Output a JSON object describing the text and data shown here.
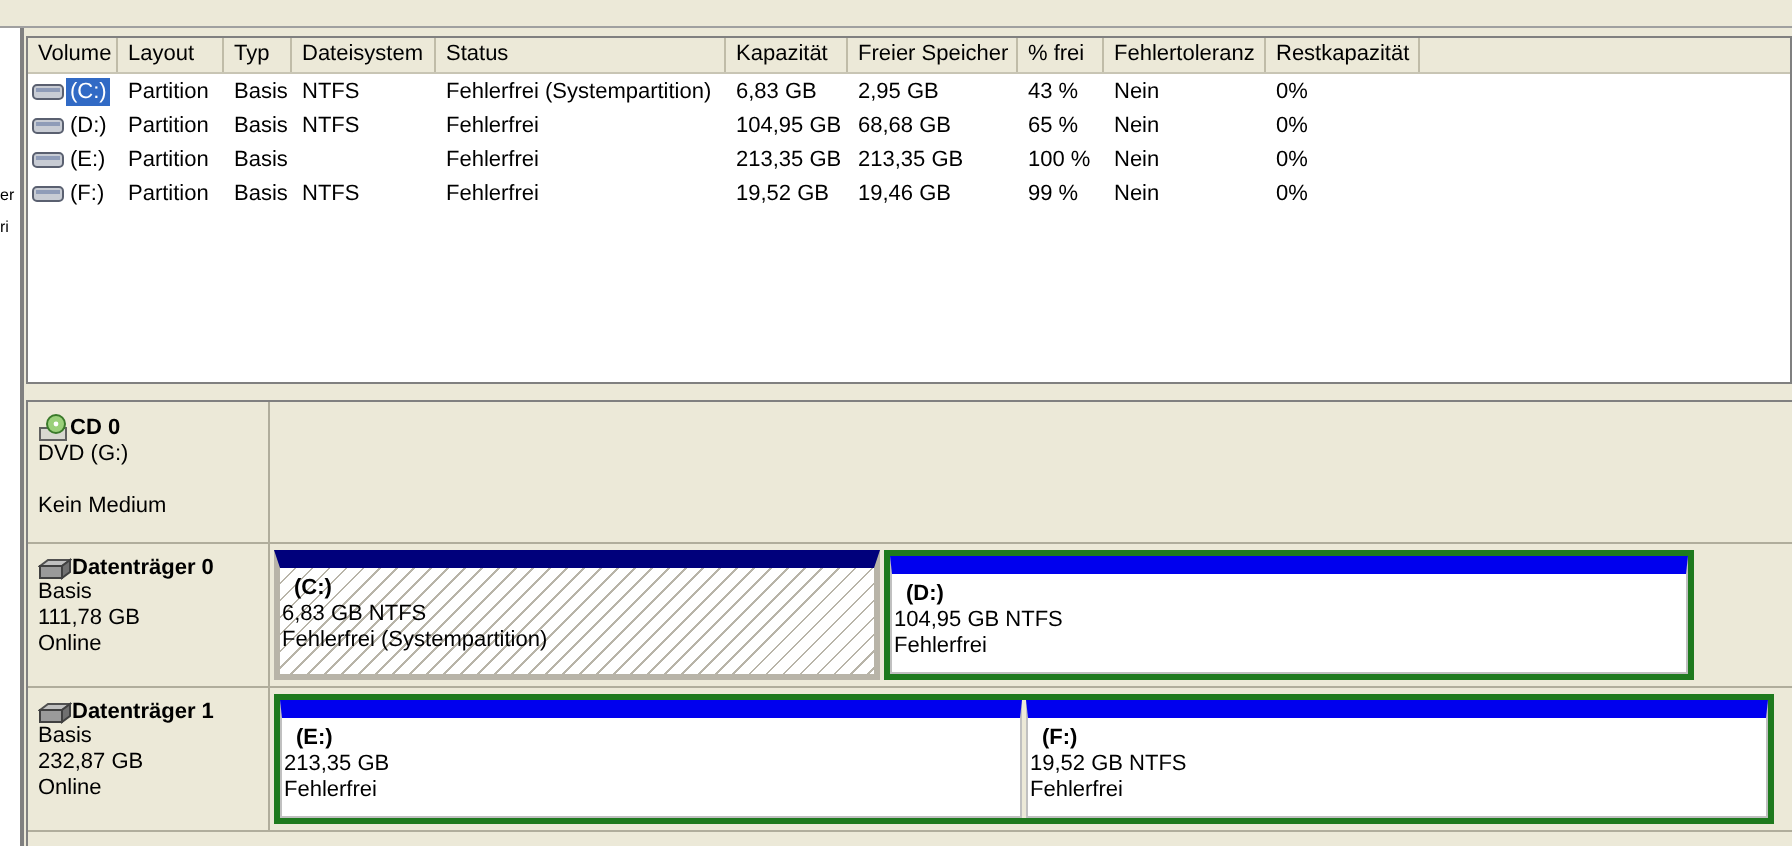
{
  "left_pane_fragments": [
    "er",
    "ri"
  ],
  "table": {
    "columns": [
      "Volume",
      "Layout",
      "Typ",
      "Dateisystem",
      "Status",
      "Kapazität",
      "Freier Speicher",
      "% frei",
      "Fehlertoleranz",
      "Restkapazität"
    ],
    "rows": [
      {
        "selected": true,
        "cells": [
          "(C:)",
          "Partition",
          "Basis",
          "NTFS",
          "Fehlerfrei (Systempartition)",
          "6,83 GB",
          "2,95 GB",
          "43 %",
          "Nein",
          "0%"
        ]
      },
      {
        "selected": false,
        "cells": [
          "(D:)",
          "Partition",
          "Basis",
          "NTFS",
          "Fehlerfrei",
          "104,95 GB",
          "68,68 GB",
          "65 %",
          "Nein",
          "0%"
        ]
      },
      {
        "selected": false,
        "cells": [
          "(E:)",
          "Partition",
          "Basis",
          "",
          "Fehlerfrei",
          "213,35 GB",
          "213,35 GB",
          "100 %",
          "Nein",
          "0%"
        ]
      },
      {
        "selected": false,
        "cells": [
          "(F:)",
          "Partition",
          "Basis",
          "NTFS",
          "Fehlerfrei",
          "19,52 GB",
          "19,46 GB",
          "99 %",
          "Nein",
          "0%"
        ]
      }
    ]
  },
  "disks": [
    {
      "kind": "cdrom",
      "name": "CD 0",
      "lines": [
        "DVD (G:)",
        "Kein Medium"
      ]
    },
    {
      "kind": "disk",
      "name": "Datenträger 0",
      "lines": [
        "Basis",
        "111,78 GB",
        "Online"
      ],
      "partitions": [
        {
          "kind": "primary",
          "selected": true,
          "label": "(C:)",
          "size": "6,83 GB NTFS",
          "status": "Fehlerfrei (Systempartition)"
        },
        {
          "kind": "logical",
          "selected": false,
          "label": "(D:)",
          "size": "104,95 GB NTFS",
          "status": "Fehlerfrei"
        }
      ]
    },
    {
      "kind": "disk",
      "name": "Datenträger 1",
      "lines": [
        "Basis",
        "232,87 GB",
        "Online"
      ],
      "partitions": [
        {
          "kind": "logical",
          "selected": false,
          "label": "(E:)",
          "size": "213,35 GB",
          "status": "Fehlerfrei"
        },
        {
          "kind": "logical",
          "selected": false,
          "label": "(F:)",
          "size": "19,52 GB NTFS",
          "status": "Fehlerfrei"
        }
      ]
    }
  ]
}
